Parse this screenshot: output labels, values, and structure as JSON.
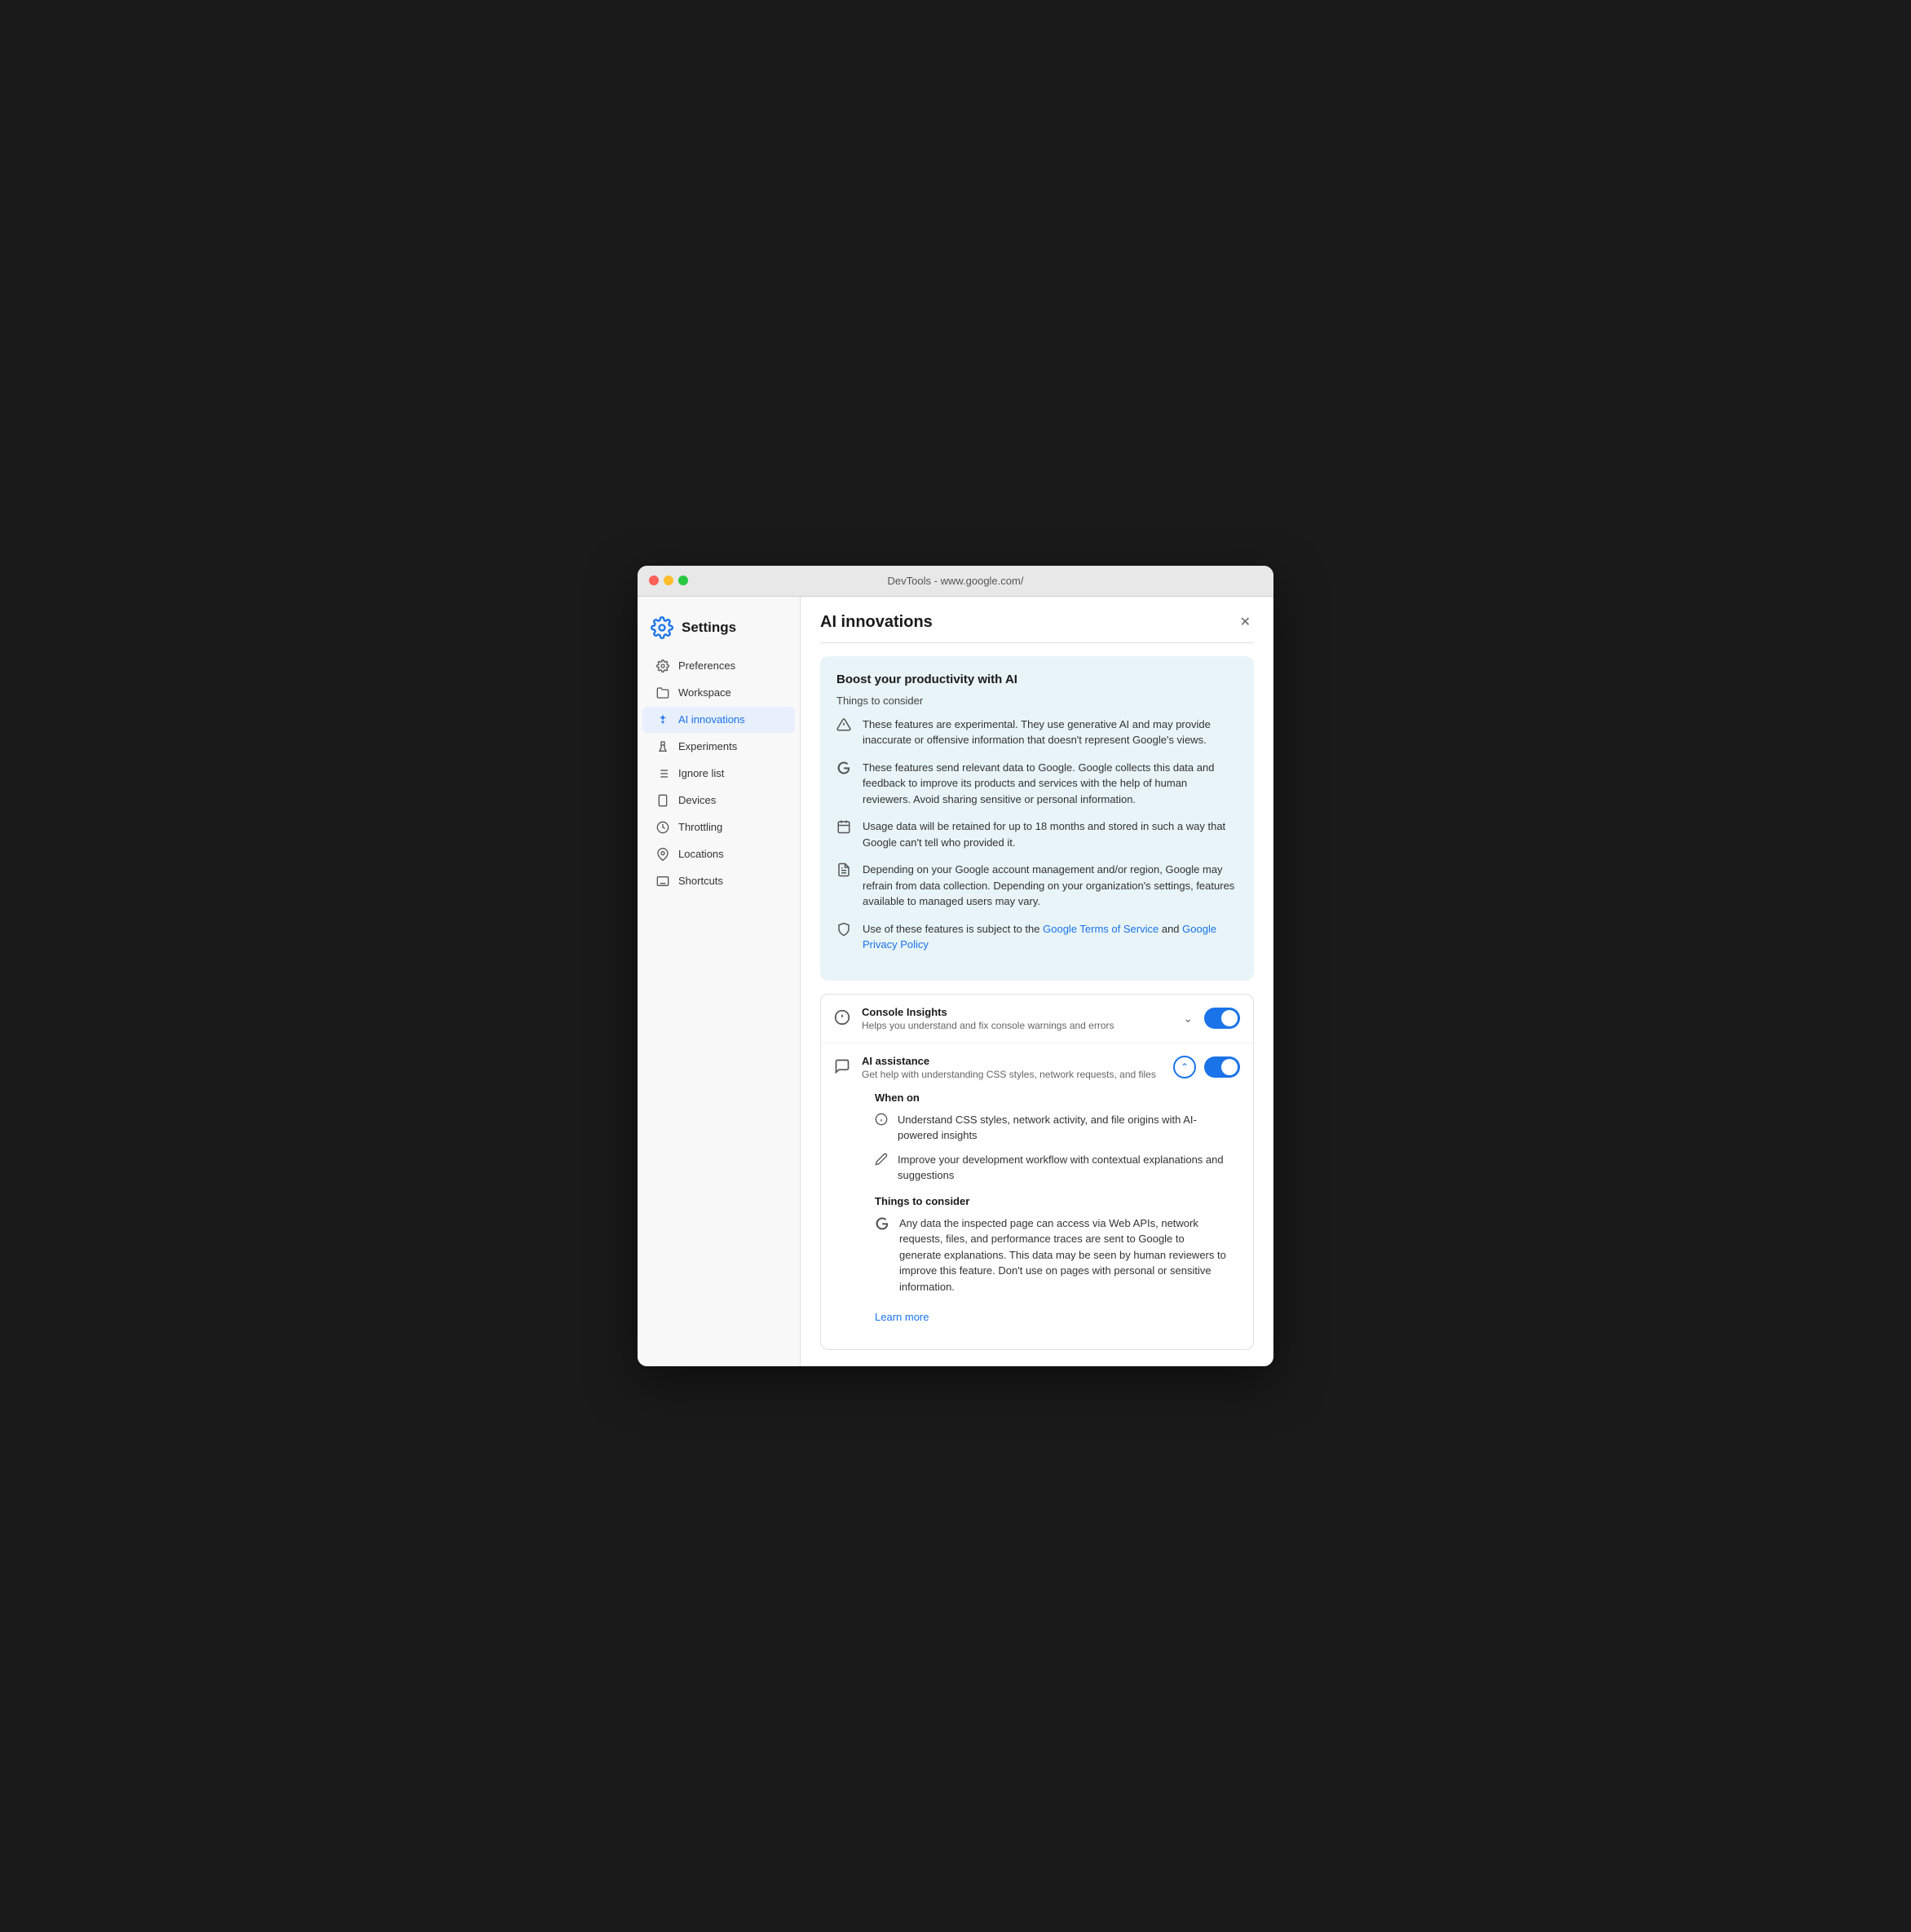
{
  "window": {
    "title": "DevTools - www.google.com/"
  },
  "sidebar": {
    "heading": "Settings",
    "items": [
      {
        "id": "preferences",
        "label": "Preferences",
        "icon": "gear"
      },
      {
        "id": "workspace",
        "label": "Workspace",
        "icon": "folder"
      },
      {
        "id": "ai-innovations",
        "label": "AI innovations",
        "icon": "sparkle",
        "active": true
      },
      {
        "id": "experiments",
        "label": "Experiments",
        "icon": "flask"
      },
      {
        "id": "ignore-list",
        "label": "Ignore list",
        "icon": "list"
      },
      {
        "id": "devices",
        "label": "Devices",
        "icon": "device"
      },
      {
        "id": "throttling",
        "label": "Throttling",
        "icon": "gauge"
      },
      {
        "id": "locations",
        "label": "Locations",
        "icon": "pin"
      },
      {
        "id": "shortcuts",
        "label": "Shortcuts",
        "icon": "keyboard"
      }
    ]
  },
  "main": {
    "title": "AI innovations",
    "info_card": {
      "title": "Boost your productivity with AI",
      "subtitle": "Things to consider",
      "considerations": [
        {
          "icon": "warning",
          "text": "These features are experimental. They use generative AI and may provide inaccurate or offensive information that doesn't represent Google's views."
        },
        {
          "icon": "google",
          "text": "These features send relevant data to Google. Google collects this data and feedback to improve its products and services with the help of human reviewers. Avoid sharing sensitive or personal information."
        },
        {
          "icon": "calendar",
          "text": "Usage data will be retained for up to 18 months and stored in such a way that Google can't tell who provided it."
        },
        {
          "icon": "doc",
          "text": "Depending on your Google account management and/or region, Google may refrain from data collection. Depending on your organization's settings, features available to managed users may vary."
        },
        {
          "icon": "shield",
          "text_before": "Use of these features is subject to the ",
          "link1_text": "Google Terms of Service",
          "link1_href": "#",
          "text_mid": " and ",
          "link2_text": "Google Privacy Policy",
          "link2_href": "#",
          "text_after": ""
        }
      ]
    },
    "features": [
      {
        "id": "console-insights",
        "icon": "bulb",
        "name": "Console Insights",
        "desc": "Helps you understand and fix console warnings and errors",
        "enabled": true,
        "expanded": false
      },
      {
        "id": "ai-assistance",
        "icon": "ai-chat",
        "name": "AI assistance",
        "desc": "Get help with understanding CSS styles, network requests, and files",
        "enabled": true,
        "expanded": true,
        "when_on_title": "When on",
        "when_on_items": [
          {
            "icon": "info",
            "text": "Understand CSS styles, network activity, and file origins with AI-powered insights"
          },
          {
            "icon": "pen",
            "text": "Improve your development workflow with contextual explanations and suggestions"
          }
        ],
        "things_title": "Things to consider",
        "things_items": [
          {
            "icon": "google",
            "text": "Any data the inspected page can access via Web APIs, network requests, files, and performance traces are sent to Google to generate explanations. This data may be seen by human reviewers to improve this feature. Don't use on pages with personal or sensitive information."
          }
        ],
        "learn_more": "Learn more"
      }
    ]
  }
}
